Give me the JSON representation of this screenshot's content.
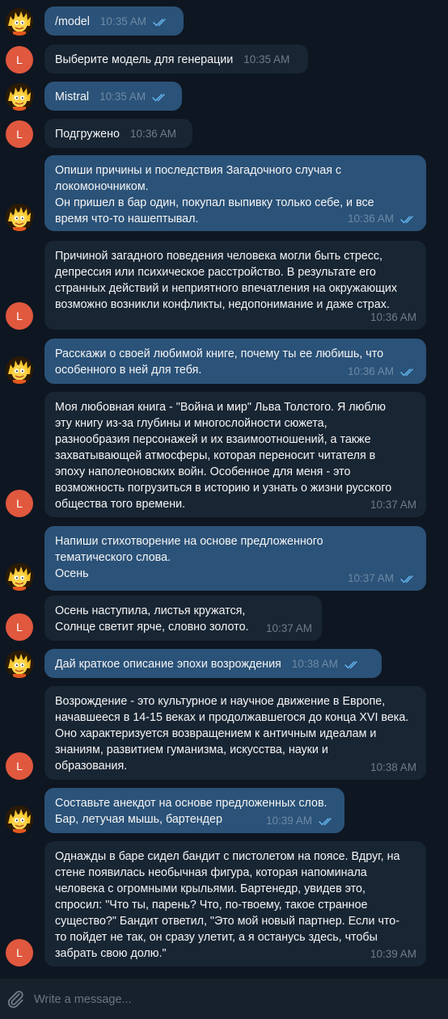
{
  "chat": {
    "messages": [
      {
        "dir": "out",
        "text": "/model",
        "time": "10:35 AM"
      },
      {
        "dir": "in",
        "avatar": "L",
        "text": "Выберите модель для генерации",
        "time": "10:35 AM"
      },
      {
        "dir": "out",
        "text": "Mistral",
        "time": "10:35 AM"
      },
      {
        "dir": "in",
        "avatar": "L",
        "text": "Подгружено",
        "time": "10:36 AM"
      },
      {
        "dir": "out",
        "text": "Опиши причины и последствия Загадочного случая с\nлокомоночником.\nОн пришел в бар один, покупал выпивку только себе, и все\nвремя что-то нашептывал.",
        "time": "10:36 AM"
      },
      {
        "dir": "in",
        "avatar": "L",
        "text": "Причиной загадного поведения человека могли быть стресс,\nдепрессия или психическое расстройство. В результате его\nстранных действий и неприятного впечатления на окружающих\nвозможно возникли конфликты, недопонимание и даже страх.",
        "time": "10:36 AM"
      },
      {
        "dir": "out",
        "text": "Расскажи о своей любимой книге, почему ты ее любишь, что\nособенного в ней для тебя.",
        "time": "10:36 AM"
      },
      {
        "dir": "in",
        "avatar": "L",
        "text": "Моя любовная книга - \"Война и мир\" Льва Толстого. Я люблю\nэту книгу из-за глубины и многослойности сюжета,\nразнообразия персонажей и их взаимоотношений, а также\nзахватывающей атмосферы, которая переносит читателя в\nэпоху наполеоновских войн. Особенное для меня - это\nвозможность погрузиться в историю и узнать о жизни русского\nобщества того времени.",
        "time": "10:37 AM"
      },
      {
        "dir": "out",
        "text": "Напиши стихотворение на основе предложенного\nтематического слова.\nОсень",
        "time": "10:37 AM"
      },
      {
        "dir": "in",
        "avatar": "L",
        "text": "Осень наступила, листья кружатся,\nСолнце светит ярче, словно золото.",
        "time": "10:37 AM"
      },
      {
        "dir": "out",
        "text": "Дай краткое описание эпохи возрождения",
        "time": "10:38 AM"
      },
      {
        "dir": "in",
        "avatar": "L",
        "text": "Возрождение - это культурное и научное движение в Европе,\nначавшееся в 14-15 веках и продолжавшегося до конца XVI века.\nОно характеризуется возвращением к античным идеалам и\nзнаниям, развитием гуманизма, искусства, науки и\nобразования.",
        "time": "10:38 AM"
      },
      {
        "dir": "out",
        "text": "Составьте анекдот на основе предложенных слов.\nБар, летучая мышь, бартендер",
        "time": "10:39 AM"
      },
      {
        "dir": "in",
        "avatar": "L",
        "text": "Однажды в баре сидел бандит с пистолетом на поясе. Вдруг, на\nстене появилась необычная фигура, которая напоминала\nчеловека с огромными крыльями. Бартенедр, увидев это,\nспросил: \"Что ты, парень? Что, по-твоему, такое странное\nсущество?\" Бандит ответил, \"Это мой новый партнер. Если что-\nто пойдет не так, он сразу улетит, а я останусь здесь, чтобы\nзабрать свою долю.\"",
        "time": "10:39 AM"
      }
    ]
  },
  "composer": {
    "placeholder": "Write a message...",
    "attach_icon": "paperclip-icon"
  },
  "icons": {
    "read_receipt": "double-check-icon",
    "user_avatar": "cartoon-avatar-icon"
  },
  "colors": {
    "background": "#0e1621",
    "outgoing_bubble": "#2b5278",
    "incoming_bubble": "#182533",
    "bot_avatar": "#e0583e",
    "read_check": "#64b5ef",
    "composer": "#17212b"
  }
}
